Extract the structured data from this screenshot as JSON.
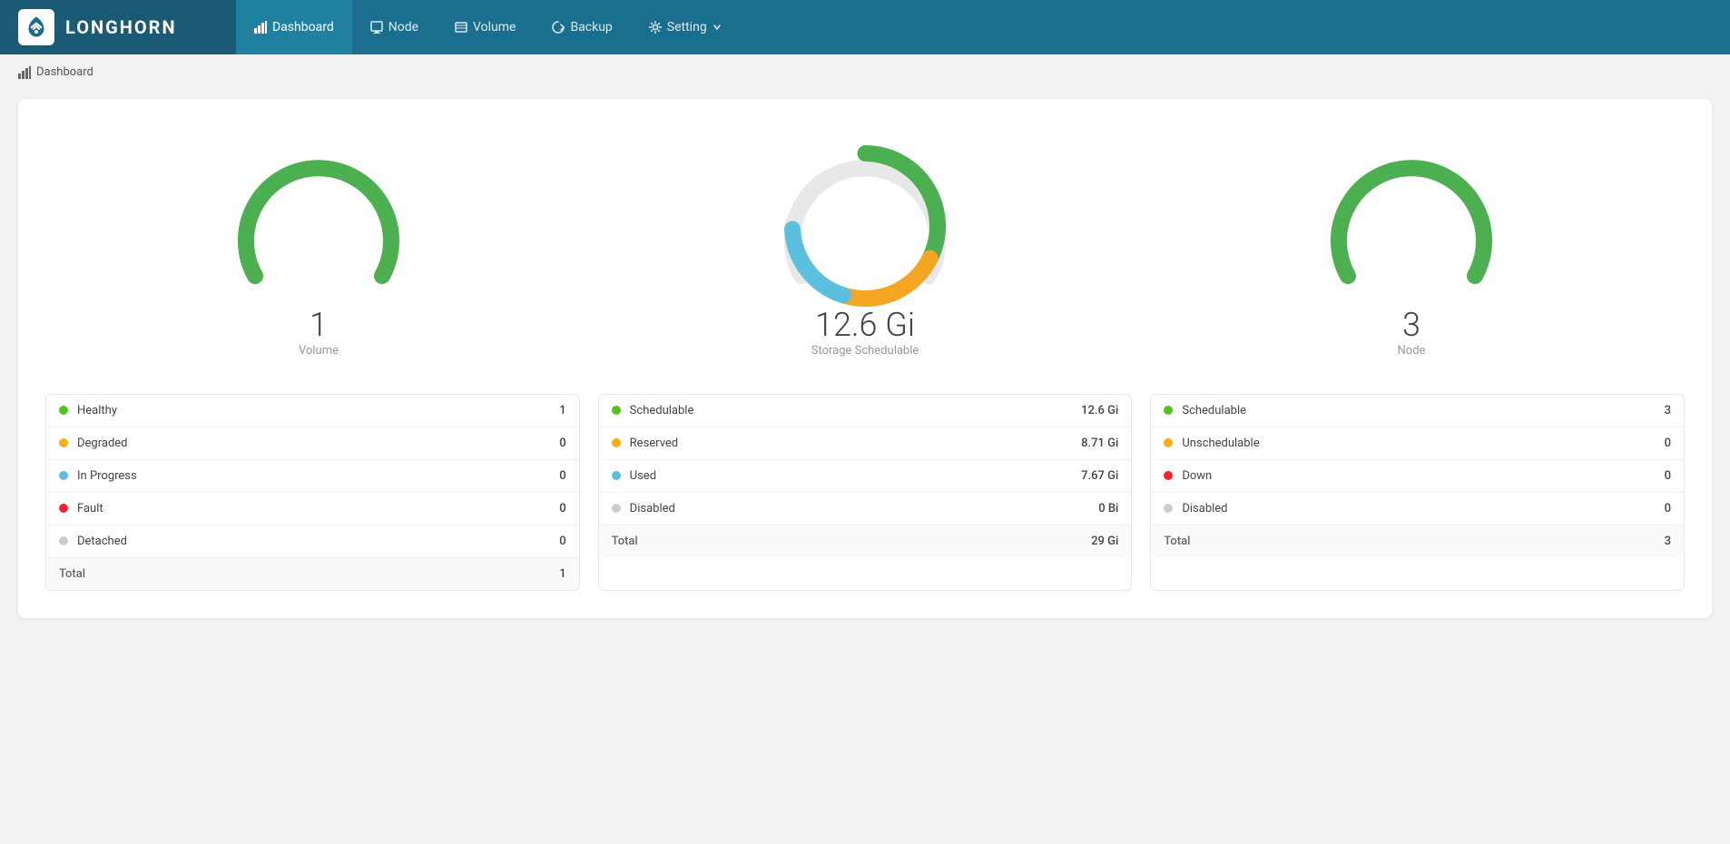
{
  "header": {
    "logo_text": "LONGHORN",
    "nav": [
      {
        "label": "Dashboard",
        "icon": "chart-icon",
        "active": true
      },
      {
        "label": "Node",
        "icon": "node-icon",
        "active": false
      },
      {
        "label": "Volume",
        "icon": "volume-icon",
        "active": false
      },
      {
        "label": "Backup",
        "icon": "backup-icon",
        "active": false
      },
      {
        "label": "Setting",
        "icon": "setting-icon",
        "active": false,
        "has_arrow": true
      }
    ]
  },
  "breadcrumb": {
    "icon": "dashboard-breadcrumb-icon",
    "text": "Dashboard"
  },
  "volume_gauge": {
    "value": "1",
    "label": "Volume",
    "color_main": "#4caf50",
    "color_bg": "#e8e8e8",
    "percent": 100,
    "stats": [
      {
        "label": "Healthy",
        "dot": "green",
        "value": "1"
      },
      {
        "label": "Degraded",
        "dot": "yellow",
        "value": "0"
      },
      {
        "label": "In Progress",
        "dot": "blue",
        "value": "0"
      },
      {
        "label": "Fault",
        "dot": "red",
        "value": "0"
      },
      {
        "label": "Detached",
        "dot": "gray",
        "value": "0"
      },
      {
        "label": "Total",
        "value": "1",
        "is_total": true
      }
    ]
  },
  "storage_gauge": {
    "value": "12.6 Gi",
    "label": "Storage Schedulable",
    "segments": {
      "schedulable_pct": 43,
      "reserved_pct": 30,
      "used_pct": 26,
      "disabled_pct": 1
    },
    "stats": [
      {
        "label": "Schedulable",
        "dot": "green",
        "value": "12.6 Gi"
      },
      {
        "label": "Reserved",
        "dot": "yellow",
        "value": "8.71 Gi"
      },
      {
        "label": "Used",
        "dot": "blue",
        "value": "7.67 Gi"
      },
      {
        "label": "Disabled",
        "dot": "gray",
        "value": "0 Bi"
      },
      {
        "label": "Total",
        "value": "29 Gi",
        "is_total": true
      }
    ]
  },
  "node_gauge": {
    "value": "3",
    "label": "Node",
    "color_main": "#4caf50",
    "percent": 100,
    "stats": [
      {
        "label": "Schedulable",
        "dot": "green",
        "value": "3"
      },
      {
        "label": "Unschedulable",
        "dot": "yellow",
        "value": "0"
      },
      {
        "label": "Down",
        "dot": "red",
        "value": "0"
      },
      {
        "label": "Disabled",
        "dot": "gray",
        "value": "0"
      },
      {
        "label": "Total",
        "value": "3",
        "is_total": true
      }
    ]
  },
  "colors": {
    "green": "#4caf50",
    "yellow": "#f5a623",
    "blue": "#5bc0de",
    "gray": "#d0d0d0",
    "red": "#f5222d",
    "gauge_bg": "#e8e8e8",
    "header_bg": "#1a6e8e",
    "logo_bg": "#155e7a"
  }
}
